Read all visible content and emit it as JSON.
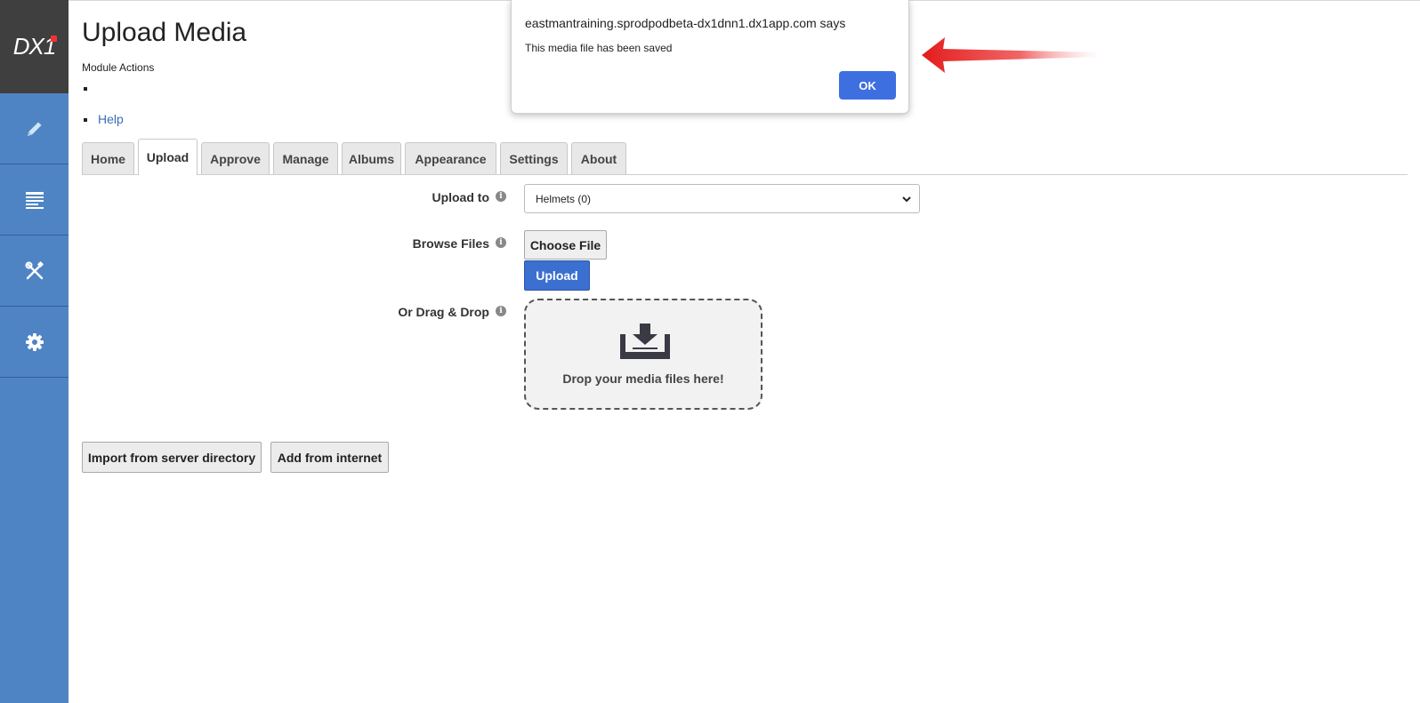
{
  "sidebar": {
    "logo": "DX1",
    "items": [
      {
        "icon": "pencil-icon",
        "name": "edit"
      },
      {
        "icon": "page-list-icon",
        "name": "pages"
      },
      {
        "icon": "tools-icon",
        "name": "tools"
      },
      {
        "icon": "gear-icon",
        "name": "settings"
      }
    ]
  },
  "header": {
    "title": "Upload Media",
    "module_actions": "Module Actions",
    "help": "Help"
  },
  "tabs": [
    {
      "label": "Home"
    },
    {
      "label": "Upload",
      "active": true
    },
    {
      "label": "Approve"
    },
    {
      "label": "Manage"
    },
    {
      "label": "Albums"
    },
    {
      "label": "Appearance"
    },
    {
      "label": "Settings"
    },
    {
      "label": "About"
    }
  ],
  "form": {
    "upload_to_label": "Upload to",
    "upload_to_value": "Helmets (0)",
    "browse_files_label": "Browse Files",
    "choose_file": "Choose File",
    "upload": "Upload",
    "drag_drop_label": "Or Drag & Drop",
    "drop_text": "Drop your media files here!"
  },
  "actions": {
    "import_server": "Import from server directory",
    "add_internet": "Add from internet"
  },
  "dialog": {
    "origin": "eastmantraining.sprodpodbeta-dx1dnn1.dx1app.com says",
    "message": "This media file has been saved",
    "ok": "OK"
  },
  "colors": {
    "sidebar": "#4f84c4",
    "logo_bg": "#3f3f3f",
    "primary_button": "#3b6fd0",
    "annotation_arrow": "#e31b1b"
  }
}
